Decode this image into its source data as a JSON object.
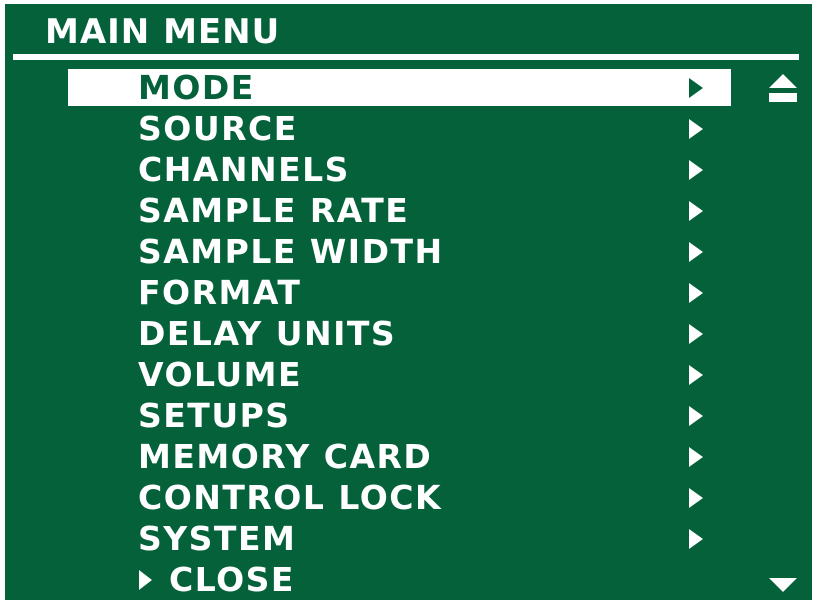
{
  "header": {
    "title": "MAIN MENU"
  },
  "menu": {
    "items": [
      {
        "label": "MODE",
        "selected": true
      },
      {
        "label": "SOURCE",
        "selected": false
      },
      {
        "label": "CHANNELS",
        "selected": false
      },
      {
        "label": "SAMPLE RATE",
        "selected": false
      },
      {
        "label": "SAMPLE WIDTH",
        "selected": false
      },
      {
        "label": "FORMAT",
        "selected": false
      },
      {
        "label": "DELAY UNITS",
        "selected": false
      },
      {
        "label": "VOLUME",
        "selected": false
      },
      {
        "label": "SETUPS",
        "selected": false
      },
      {
        "label": "MEMORY CARD",
        "selected": false
      },
      {
        "label": "CONTROL LOCK",
        "selected": false
      },
      {
        "label": "SYSTEM",
        "selected": false
      }
    ],
    "close_label": "CLOSE"
  },
  "icons": {
    "item_arrow": "chevron-right-icon",
    "scroll_up": "scroll-up-icon",
    "scroll_down": "scroll-down-icon"
  },
  "colors": {
    "background": "#04613a",
    "foreground": "#ffffff",
    "selected_text": "#04613a"
  }
}
